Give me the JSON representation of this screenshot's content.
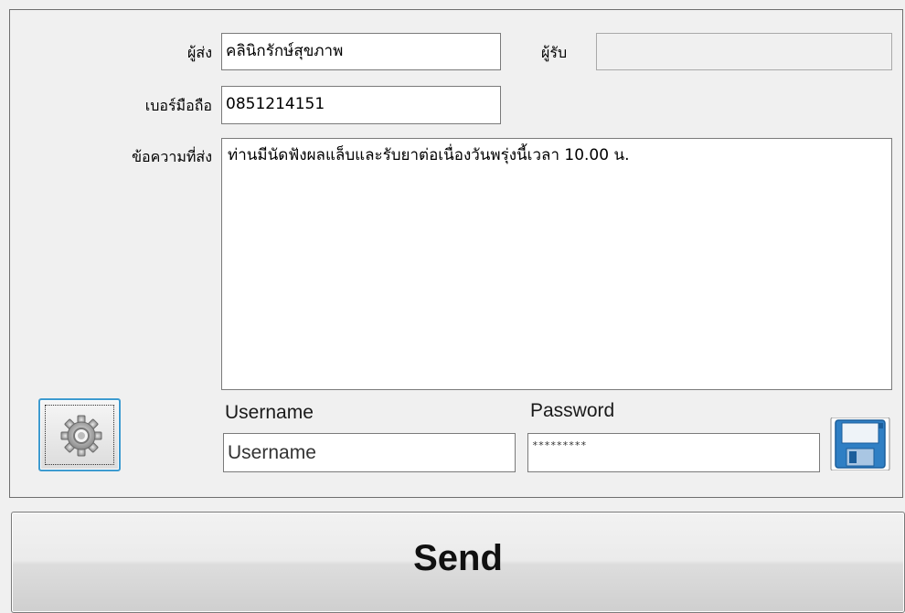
{
  "form": {
    "sender_label": "ผู้ส่ง",
    "sender_value": "คลินิกรักษ์สุขภาพ",
    "receiver_label": "ผู้รับ",
    "receiver_value": "",
    "phone_label": "เบอร์มือถือ",
    "phone_value": "0851214151",
    "message_label": "ข้อความที่ส่ง",
    "message_value": "ท่านมีนัดฟังผลแล็บและรับยาต่อเนื่องวันพรุ่งนี้เวลา 10.00 น."
  },
  "credentials": {
    "username_label": "Username",
    "username_value": "Username",
    "password_label": "Password",
    "password_value": "*********"
  },
  "buttons": {
    "settings_icon": "gear-icon",
    "save_icon": "floppy-disk-icon",
    "send_label": "Send"
  },
  "colors": {
    "focus_border": "#3d9bd0",
    "save_icon_blue": "#2f7fc4"
  }
}
